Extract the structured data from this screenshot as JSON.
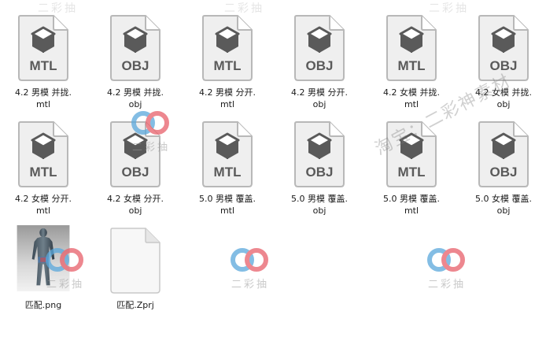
{
  "files": [
    {
      "type": "MTL",
      "line1": "4.2 男模 并拢.",
      "line2": "mtl"
    },
    {
      "type": "OBJ",
      "line1": "4.2 男模 并拢.",
      "line2": "obj"
    },
    {
      "type": "MTL",
      "line1": "4.2 男模 分开.",
      "line2": "mtl"
    },
    {
      "type": "OBJ",
      "line1": "4.2 男模 分开.",
      "line2": "obj"
    },
    {
      "type": "MTL",
      "line1": "4.2 女模 并拢.",
      "line2": "mtl"
    },
    {
      "type": "OBJ",
      "line1": "4.2 女模 并拢.",
      "line2": "obj"
    },
    {
      "type": "MTL",
      "line1": "4.2 女模 分开.",
      "line2": "mtl"
    },
    {
      "type": "OBJ",
      "line1": "4.2 女模 分开.",
      "line2": "obj"
    },
    {
      "type": "MTL",
      "line1": "5.0 男模 覆盖.",
      "line2": "mtl"
    },
    {
      "type": "OBJ",
      "line1": "5.0 男模 覆盖.",
      "line2": "obj"
    },
    {
      "type": "MTL",
      "line1": "5.0 男模 覆盖.",
      "line2": "mtl"
    },
    {
      "type": "OBJ",
      "line1": "5.0 女模 覆盖.",
      "line2": "obj"
    },
    {
      "type": "PNG",
      "line1": "匹配.png",
      "line2": ""
    },
    {
      "type": "ZPRJ",
      "line1": "匹配.Zprj",
      "line2": ""
    }
  ],
  "watermark": {
    "diagonal": "淘宝：二彩神素材",
    "logo_text": "二彩抽",
    "top_text": "二彩抽"
  },
  "colors": {
    "icon_fill": "#5a5a5a",
    "icon_body": "#efefef",
    "icon_border": "#b8b8b8",
    "wm_blue": "#5aa8dc",
    "wm_red": "#e8606a"
  }
}
